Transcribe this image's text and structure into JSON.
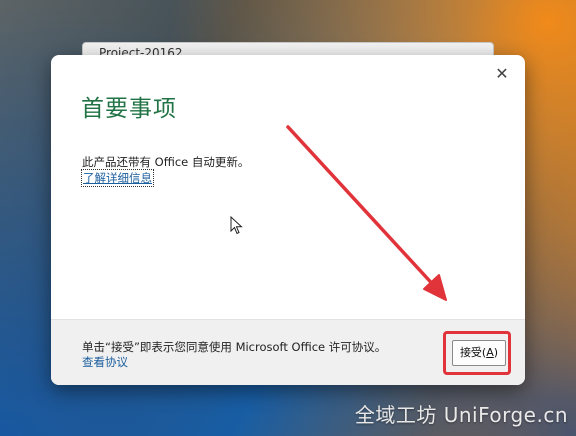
{
  "background_window": {
    "title": "Project-20162"
  },
  "dialog": {
    "title": "首要事项",
    "close_label": "✕",
    "message": "此产品还带有 Office 自动更新。",
    "learn_more_link": "了解详细信息",
    "footer": {
      "license_text": "单击“接受”即表示您同意使用 Microsoft Office 许可协议。",
      "view_agreement_link": "查看协议",
      "accept_button_label": "接受(",
      "accept_button_accel": "A",
      "accept_button_suffix": ")"
    }
  },
  "colors": {
    "title_green": "#217346",
    "link_blue": "#1b5e9e",
    "highlight_red": "#e0343a"
  },
  "watermark": {
    "text": "全域工坊 UniForge.cn"
  }
}
